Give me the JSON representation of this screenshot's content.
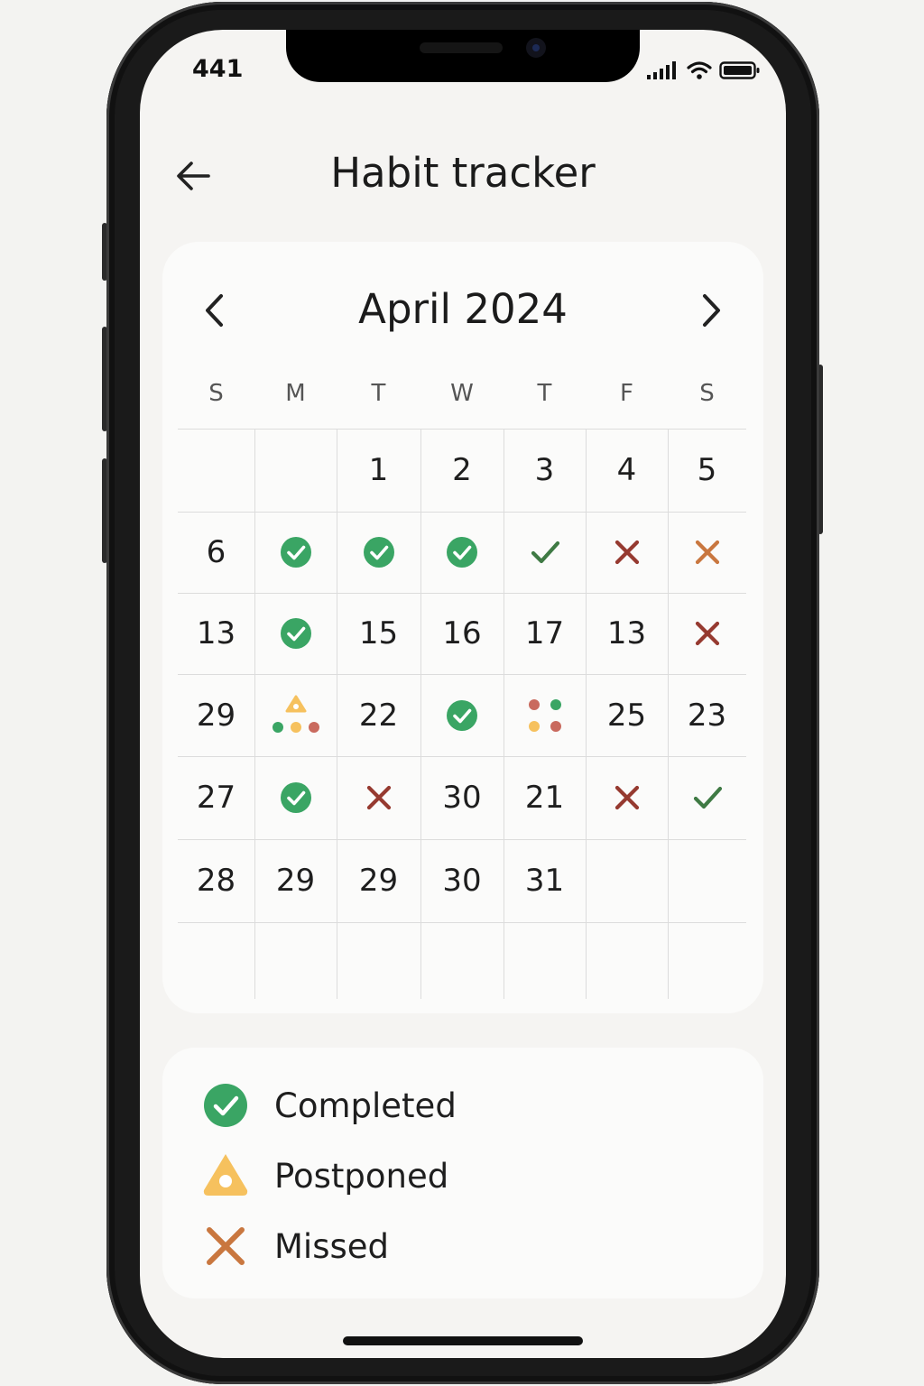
{
  "status_bar": {
    "time": "441"
  },
  "header": {
    "title": "Habit tracker"
  },
  "calendar": {
    "month_label": "April 2024",
    "weekdays": [
      "S",
      "M",
      "T",
      "W",
      "T",
      "F",
      "S"
    ],
    "rows": [
      [
        {
          "t": ""
        },
        {
          "t": ""
        },
        {
          "t": "1"
        },
        {
          "t": "2"
        },
        {
          "t": "3"
        },
        {
          "t": "4"
        },
        {
          "t": "5"
        }
      ],
      [
        {
          "t": "6"
        },
        {
          "i": "completed-circle"
        },
        {
          "i": "completed-circle"
        },
        {
          "i": "completed-circle"
        },
        {
          "i": "check-dark"
        },
        {
          "i": "x-red"
        },
        {
          "i": "x-orange"
        }
      ],
      [
        {
          "t": "13"
        },
        {
          "i": "completed-circle"
        },
        {
          "t": "15"
        },
        {
          "t": "16"
        },
        {
          "t": "17"
        },
        {
          "t": "13"
        },
        {
          "i": "x-red"
        }
      ],
      [
        {
          "t": "29"
        },
        {
          "i": "postponed-dots"
        },
        {
          "t": "22"
        },
        {
          "i": "completed-circle"
        },
        {
          "i": "four-dots"
        },
        {
          "t": "25"
        },
        {
          "t": "23"
        }
      ],
      [
        {
          "t": "27"
        },
        {
          "i": "completed-circle"
        },
        {
          "i": "x-red"
        },
        {
          "t": "30"
        },
        {
          "t": "21"
        },
        {
          "i": "x-red"
        },
        {
          "i": "check-dark"
        }
      ],
      [
        {
          "t": "28"
        },
        {
          "t": "29"
        },
        {
          "t": "29"
        },
        {
          "t": "30"
        },
        {
          "t": "31"
        },
        {
          "t": ""
        },
        {
          "t": ""
        }
      ],
      [
        {
          "t": ""
        },
        {
          "t": ""
        },
        {
          "t": ""
        },
        {
          "t": ""
        },
        {
          "t": ""
        },
        {
          "t": ""
        },
        {
          "t": ""
        }
      ]
    ]
  },
  "legend": [
    {
      "icon": "completed-circle",
      "label": "Completed"
    },
    {
      "icon": "postponed-diamond",
      "label": "Postponed"
    },
    {
      "icon": "missed-x",
      "label": "Missed"
    }
  ],
  "colors": {
    "completed": "#3aa564",
    "check_dark": "#3f7a44",
    "missed_red": "#963a30",
    "missed_orange": "#c9773f",
    "postponed": "#f6c15e"
  }
}
